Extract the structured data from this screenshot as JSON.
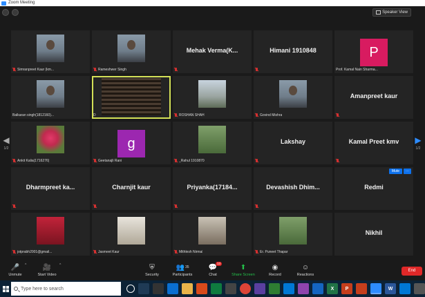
{
  "window": {
    "title": "Zoom Meeting"
  },
  "top": {
    "speaker_view_label": "Speaker View"
  },
  "pager": {
    "left": "1/2",
    "right": "1/2"
  },
  "tile_controls": {
    "mute_label": "Mute",
    "more_label": "···"
  },
  "tiles": [
    {
      "label": "Simranpreet Kaur (km...",
      "big_name": "",
      "video": "v-person",
      "muted": true
    },
    {
      "label": "Rameshwer Singh",
      "big_name": "",
      "video": "v-person",
      "muted": true
    },
    {
      "label": "",
      "big_name": "Mehak Verma(K...",
      "video": "",
      "muted": true
    },
    {
      "label": "",
      "big_name": "Himani 1910848",
      "video": "",
      "muted": true
    },
    {
      "label": "Prof. Kamal Nain Sharma...",
      "big_name": "",
      "video": "",
      "avatar_letter": "P",
      "avatar_color": "#d81b60",
      "muted": false
    },
    {
      "label": "Balkaran singh(1812160)...",
      "big_name": "",
      "video": "v-person",
      "muted": false
    },
    {
      "label": "D",
      "big_name": "",
      "video": "v-blinds",
      "muted": false,
      "active": true
    },
    {
      "label": "ROSHAN SHAH",
      "big_name": "",
      "video": "v-sky",
      "muted": true
    },
    {
      "label": "Govind Mishra",
      "big_name": "",
      "video": "v-person",
      "muted": true
    },
    {
      "label": "",
      "big_name": "Amanpreet kaur",
      "video": "",
      "muted": true
    },
    {
      "label": "Ankit Kalia(1716276)",
      "big_name": "",
      "video": "v-flower",
      "muted": true
    },
    {
      "label": "Geetanajli Rani",
      "big_name": "",
      "video": "",
      "avatar_letter": "g",
      "avatar_color": "#9c27b0",
      "muted": true
    },
    {
      "label": "_Rahul 1910870",
      "big_name": "",
      "video": "v-green",
      "muted": true
    },
    {
      "label": "",
      "big_name": "Lakshay",
      "video": "",
      "muted": true
    },
    {
      "label": "",
      "big_name": "Kamal Preet kmv",
      "video": "",
      "muted": true
    },
    {
      "label": "",
      "big_name": "Dharmpreet ka...",
      "video": "",
      "muted": true
    },
    {
      "label": "",
      "big_name": "Charnjit kaur",
      "video": "",
      "muted": true
    },
    {
      "label": "",
      "big_name": "Priyanka(17184...",
      "video": "",
      "muted": true
    },
    {
      "label": "",
      "big_name": "Devashish Dhim...",
      "video": "",
      "muted": true
    },
    {
      "label": "",
      "big_name": "Redmi",
      "video": "",
      "muted": false,
      "hover": true
    },
    {
      "label": "jotprabh2001@gmail...",
      "big_name": "",
      "video": "v-red",
      "muted": true
    },
    {
      "label": "Jasmeet Kaur",
      "big_name": "",
      "video": "v-white",
      "muted": true
    },
    {
      "label": "Mithlesh Nirmal",
      "big_name": "",
      "video": "v-room",
      "muted": true
    },
    {
      "label": "Er. Puneet Thapar",
      "big_name": "",
      "video": "v-green",
      "muted": true
    },
    {
      "label": "",
      "big_name": "Nikhil",
      "video": "",
      "muted": false
    }
  ],
  "toolbar": {
    "unmute": "Unmute",
    "start_video": "Start Video",
    "security": "Security",
    "participants": "Participants",
    "participants_count": "35",
    "chat": "Chat",
    "chat_badge": "13",
    "share_screen": "Share Screen",
    "record": "Record",
    "reactions": "Reactions",
    "end": "End"
  },
  "taskbar": {
    "search_placeholder": "Type here to search"
  }
}
